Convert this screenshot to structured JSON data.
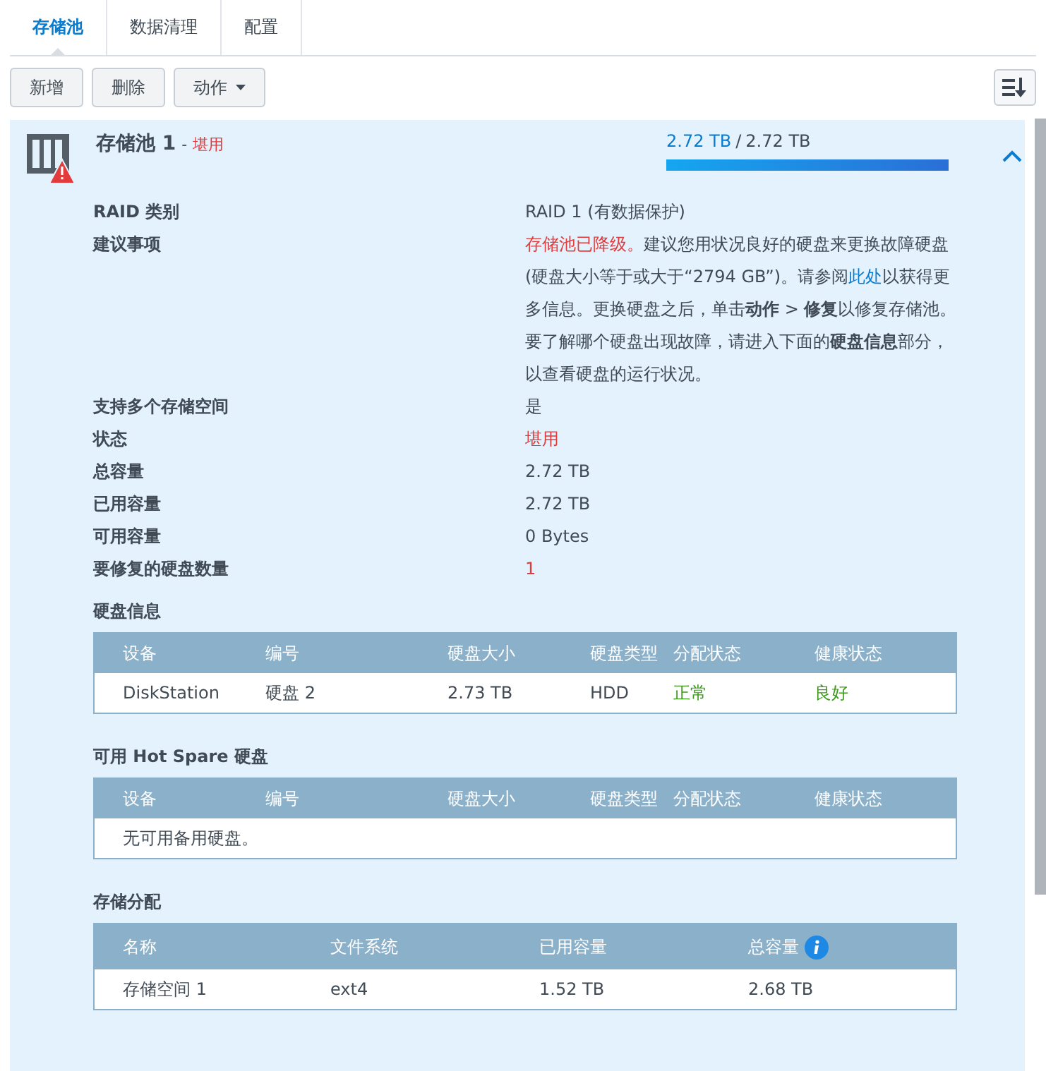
{
  "tabs": [
    {
      "label": "存储池",
      "selected": true
    },
    {
      "label": "数据清理",
      "selected": false
    },
    {
      "label": "配置",
      "selected": false
    }
  ],
  "toolbar": {
    "buttons": [
      "新增",
      "删除"
    ],
    "action_menu": "动作"
  },
  "pool": {
    "name": "存储池 1",
    "separator": "-",
    "status": "堪用",
    "used": "2.72 TB",
    "slash": "/",
    "total": "2.72 TB",
    "level": 1,
    "expanded": true,
    "info": [
      {
        "label": "RAID 类别",
        "value": "RAID 1 (有数据保护)",
        "kind": "plain"
      },
      {
        "label": "建议事项",
        "kind": "advice",
        "segments": [
          {
            "text": "存储池已降级。",
            "kind": "alert"
          },
          {
            "text": "建议您用状况良好的硬盘来更换故障硬盘(硬盘大小等于或大于“2794 GB”)。请参阅",
            "kind": "plain"
          },
          {
            "text": "此处",
            "kind": "link"
          },
          {
            "text": "以获得更多信息。更换硬盘之后，单击",
            "kind": "plain"
          },
          {
            "text": "动作",
            "kind": "bold"
          },
          {
            "text": " > ",
            "kind": "plain"
          },
          {
            "text": "修复",
            "kind": "bold"
          },
          {
            "text": "以修复存储池。要了解哪个硬盘出现故障，请进入下面的",
            "kind": "plain"
          },
          {
            "text": "硬盘信息",
            "kind": "bold"
          },
          {
            "text": "部分，以查看硬盘的运行状况。",
            "kind": "plain"
          }
        ]
      },
      {
        "label": "支持多个存储空间",
        "value": "是",
        "kind": "plain"
      },
      {
        "label": "状态",
        "value": "堪用",
        "kind": "alert"
      },
      {
        "label": "总容量",
        "value": "2.72 TB",
        "kind": "plain"
      },
      {
        "label": "已用容量",
        "value": "2.72 TB",
        "kind": "plain"
      },
      {
        "label": "可用容量",
        "value": "0 Bytes",
        "kind": "plain"
      },
      {
        "label": "要修复的硬盘数量",
        "value": "1",
        "kind": "alert"
      }
    ]
  },
  "disk_info": {
    "title": "硬盘信息",
    "columns": [
      "设备",
      "编号",
      "硬盘大小",
      "硬盘类型",
      "分配状态",
      "健康状态"
    ],
    "rows": [
      [
        {
          "text": "DiskStation",
          "kind": "plain"
        },
        {
          "text": "硬盘 2",
          "kind": "plain"
        },
        {
          "text": "2.73 TB",
          "kind": "plain"
        },
        {
          "text": "HDD",
          "kind": "plain"
        },
        {
          "text": "正常",
          "kind": "ok"
        },
        {
          "text": "良好",
          "kind": "ok"
        }
      ]
    ]
  },
  "hot_spare": {
    "title": "可用 Hot Spare 硬盘",
    "columns": [
      "设备",
      "编号",
      "硬盘大小",
      "硬盘类型",
      "分配状态",
      "健康状态"
    ],
    "empty": "无可用备用硬盘。"
  },
  "allocation": {
    "title": "存储分配",
    "columns": [
      {
        "label": "名称",
        "info": false
      },
      {
        "label": "文件系统",
        "info": false
      },
      {
        "label": "已用容量",
        "info": false
      },
      {
        "label": "总容量",
        "info": true
      }
    ],
    "rows": [
      [
        "存储空间 1",
        "ext4",
        "1.52 TB",
        "2.68 TB"
      ]
    ]
  }
}
